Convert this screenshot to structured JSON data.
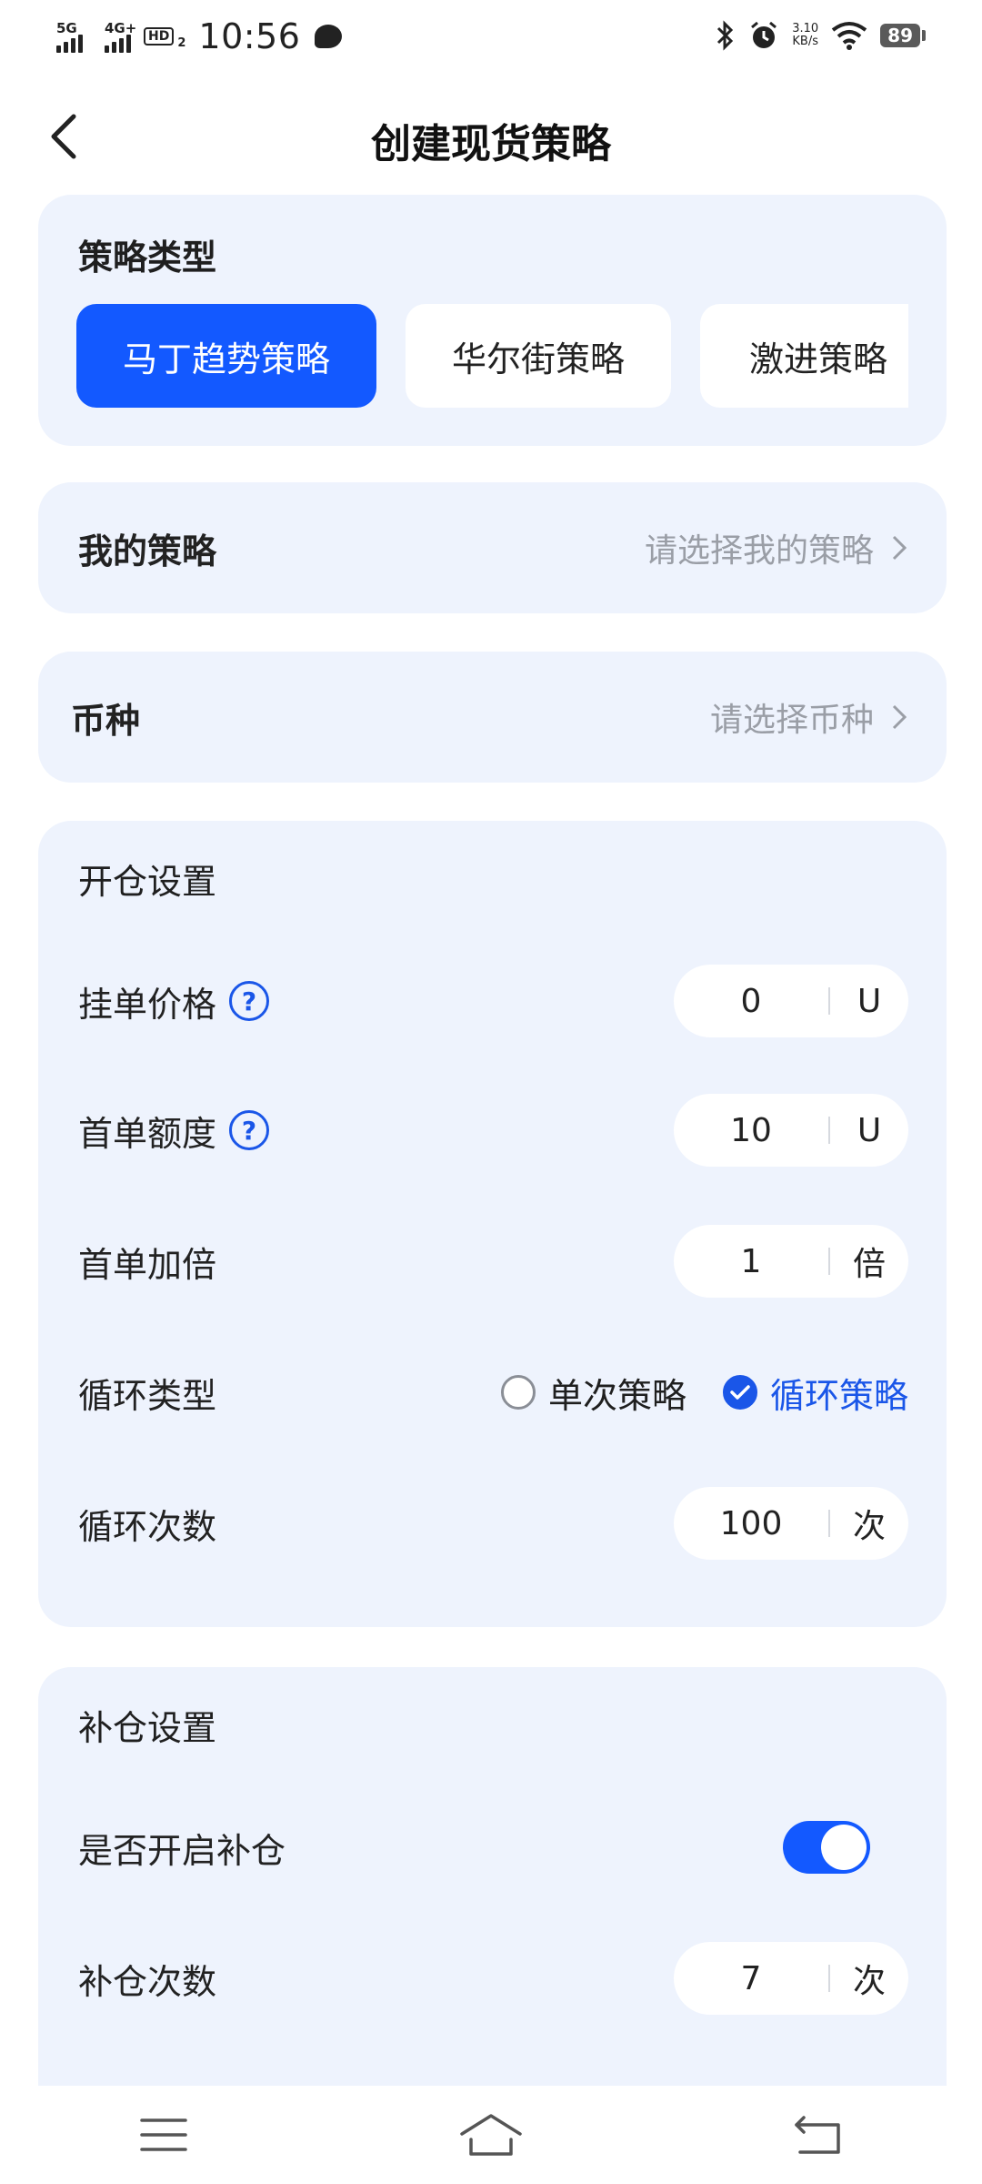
{
  "status_bar": {
    "sim1": "5G",
    "sim2": "4G+",
    "hd": "HD",
    "hd_sub": "2",
    "time": "10:56",
    "speed_value": "3.10",
    "speed_unit": "KB/s",
    "battery": "89"
  },
  "header": {
    "title": "创建现货策略"
  },
  "strategy_type": {
    "title": "策略类型",
    "options": [
      "马丁趋势策略",
      "华尔街策略",
      "激进策略"
    ],
    "selected": "马丁趋势策略"
  },
  "my_strategy": {
    "label": "我的策略",
    "placeholder": "请选择我的策略"
  },
  "coin": {
    "label": "币种",
    "placeholder": "请选择币种"
  },
  "open_settings": {
    "title": "开仓设置",
    "order_price": {
      "label": "挂单价格",
      "value": "0",
      "unit": "U"
    },
    "first_amount": {
      "label": "首单额度",
      "value": "10",
      "unit": "U"
    },
    "first_multiplier": {
      "label": "首单加倍",
      "value": "1",
      "unit": "倍"
    },
    "loop_type": {
      "label": "循环类型",
      "options": [
        "单次策略",
        "循环策略"
      ],
      "selected": "循环策略"
    },
    "loop_count": {
      "label": "循环次数",
      "value": "100",
      "unit": "次"
    }
  },
  "add_settings": {
    "title": "补仓设置",
    "enable": {
      "label": "是否开启补仓",
      "on": true
    },
    "count": {
      "label": "补仓次数",
      "value": "7",
      "unit": "次"
    }
  },
  "nav": {
    "menu_icon": "menu-icon",
    "home_icon": "home-icon",
    "back_icon": "back-icon"
  },
  "colors": {
    "accent": "#1359ff",
    "card_bg": "#eef3fd",
    "muted_text": "#9a9ea6"
  }
}
